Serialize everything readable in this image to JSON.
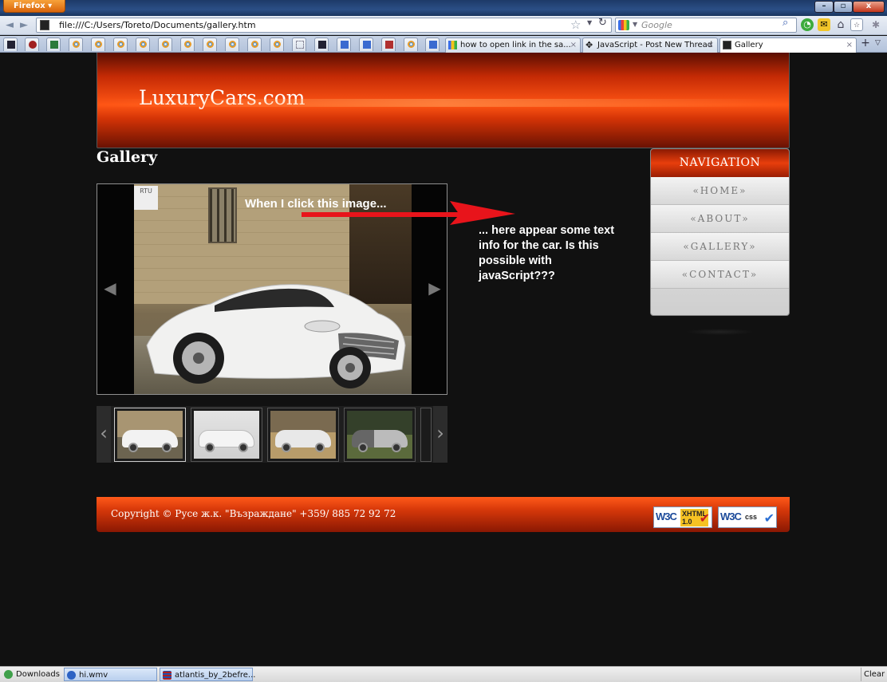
{
  "browser": {
    "app_button_label": "Firefox",
    "window_controls": {
      "minimize": "–",
      "maximize": "▫",
      "close": "x"
    },
    "url": "file:///C:/Users/Toreto/Documents/gallery.htm",
    "search_placeholder": "Google",
    "tabs": [
      {
        "label": "how to open link in the sa...",
        "close": "×",
        "active": false
      },
      {
        "label": "JavaScript - Post New Thread",
        "close": "×",
        "active": false
      },
      {
        "label": "Gallery",
        "close": "×",
        "active": true
      }
    ],
    "new_tab_label": "+"
  },
  "page": {
    "site_logo": "LuxuryCars.com",
    "gallery_title": "Gallery",
    "photo_sign_text": "RTU",
    "annotation_top": "When I click this image...",
    "annotation_side": "... here appear some text info for the car. Is this possible with javaScript???",
    "navigation": {
      "header": "NAVIGATION",
      "items": [
        "«HOME»",
        "«ABOUT»",
        "«GALLERY»",
        "«CONTACT»"
      ]
    },
    "footer": {
      "copyright": "Copyright © Русе ж.к. \"Възраждане\" +359/ 885 72 92 72",
      "badges": [
        {
          "w3c": "W3C",
          "standard_line1": "XHTML",
          "standard_line2": "1.0"
        },
        {
          "w3c": "W3C",
          "standard_line1": "css"
        }
      ]
    },
    "arrow_color": "#e8141b",
    "accent_color": "#ff5514"
  },
  "taskbar": {
    "items": [
      "Downloads",
      "hi.wmv",
      "atlantis_by_2befre..."
    ],
    "clear_label": "Clear"
  }
}
